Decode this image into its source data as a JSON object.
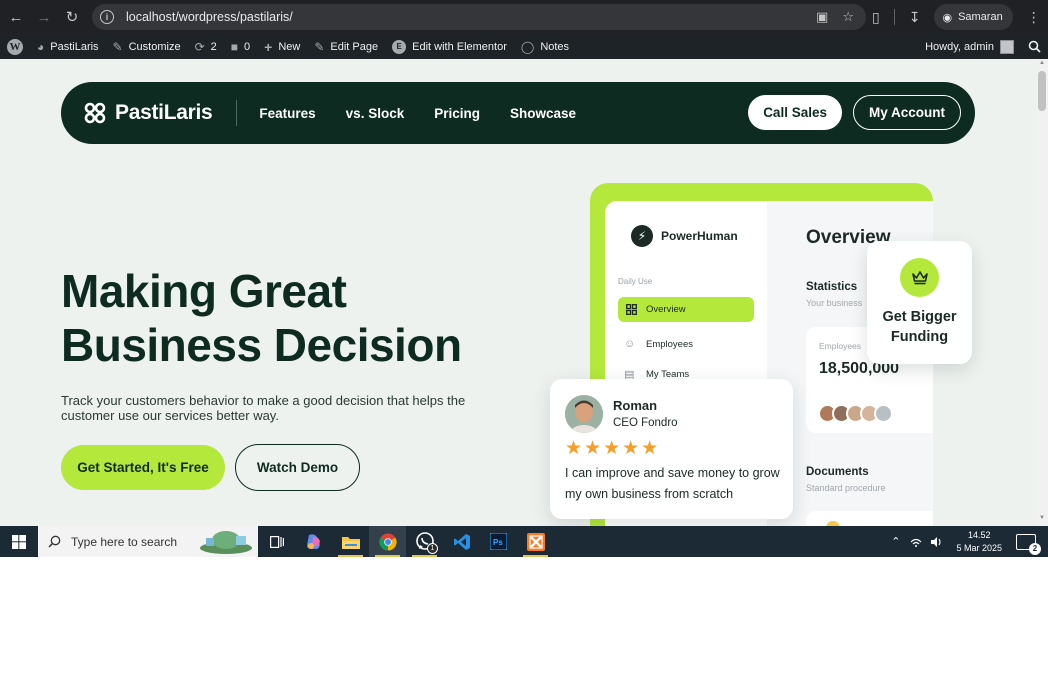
{
  "browser": {
    "url": "localhost/wordpress/pastilaris/",
    "profile_name": "Samaran"
  },
  "wp_admin_bar": {
    "site_name": "PastiLaris",
    "customize": "Customize",
    "updates_count": "2",
    "comments_count": "0",
    "new": "New",
    "edit_page": "Edit Page",
    "edit_elementor": "Edit with Elementor",
    "notes": "Notes",
    "howdy": "Howdy, admin"
  },
  "site_nav": {
    "brand": "PastiLaris",
    "links": [
      "Features",
      "vs. Slock",
      "Pricing",
      "Showcase"
    ],
    "call_sales": "Call Sales",
    "my_account": "My Account"
  },
  "hero": {
    "title_line1": "Making Great",
    "title_line2": "Business Decision",
    "subtitle": "Track your customers behavior to make a good decision that helps the customer use our services better way.",
    "cta_primary": "Get Started, It's Free",
    "cta_secondary": "Watch Demo"
  },
  "mockup": {
    "app_name": "PowerHuman",
    "section_label": "Daily Use",
    "menu": [
      "Overview",
      "Employees",
      "My Teams"
    ],
    "overview_title": "Overview",
    "statistics_title": "Statistics",
    "statistics_sub": "Your business",
    "employees_label": "Employees",
    "employees_value": "18,500,000",
    "documents_title": "Documents",
    "documents_sub": "Standard procedure"
  },
  "funding_card": {
    "line1": "Get Bigger",
    "line2": "Funding"
  },
  "review_card": {
    "name": "Roman",
    "role": "CEO Fondro",
    "rating": 5,
    "stars": "★★★★★",
    "text": "I can improve and save money to grow my own business from scratch"
  },
  "taskbar": {
    "search_placeholder": "Type here to search",
    "whatsapp_badge": "1",
    "time": "14.52",
    "date": "5 Mar 2025",
    "notification_count": "2"
  },
  "colors": {
    "brand_dark": "#0d2b21",
    "accent_lime": "#b4e83a",
    "star_orange": "#f59e2a",
    "page_bg": "#eef2ef"
  }
}
